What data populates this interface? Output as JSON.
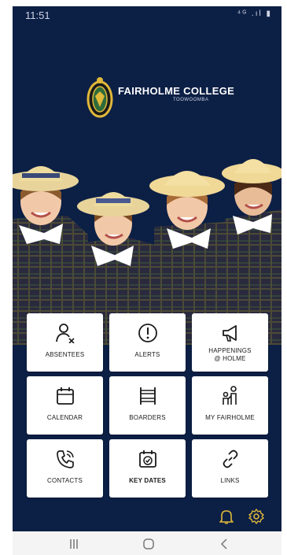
{
  "status": {
    "time": "11:51",
    "icons": "⁴ᴳ .ıl ▮"
  },
  "branding": {
    "college": "FAIRHOLME COLLEGE",
    "location": "TOOWOOMBA"
  },
  "tiles": [
    {
      "label": "ABSENTEES",
      "icon": "person-x-icon"
    },
    {
      "label": "ALERTS",
      "icon": "alert-icon"
    },
    {
      "label": "HAPPENINGS\n@ HOLME",
      "icon": "megaphone-icon"
    },
    {
      "label": "CALENDAR",
      "icon": "calendar-icon"
    },
    {
      "label": "BOARDERS",
      "icon": "bunk-bed-icon"
    },
    {
      "label": "MY FAIRHOLME",
      "icon": "parent-child-icon"
    },
    {
      "label": "CONTACTS",
      "icon": "phone-icon"
    },
    {
      "label": "KEY DATES",
      "icon": "calendar-check-icon"
    },
    {
      "label": "LINKS",
      "icon": "link-icon"
    }
  ],
  "colors": {
    "background": "#0c1f45",
    "accent": "#e0b83a",
    "tile": "#ffffff"
  }
}
